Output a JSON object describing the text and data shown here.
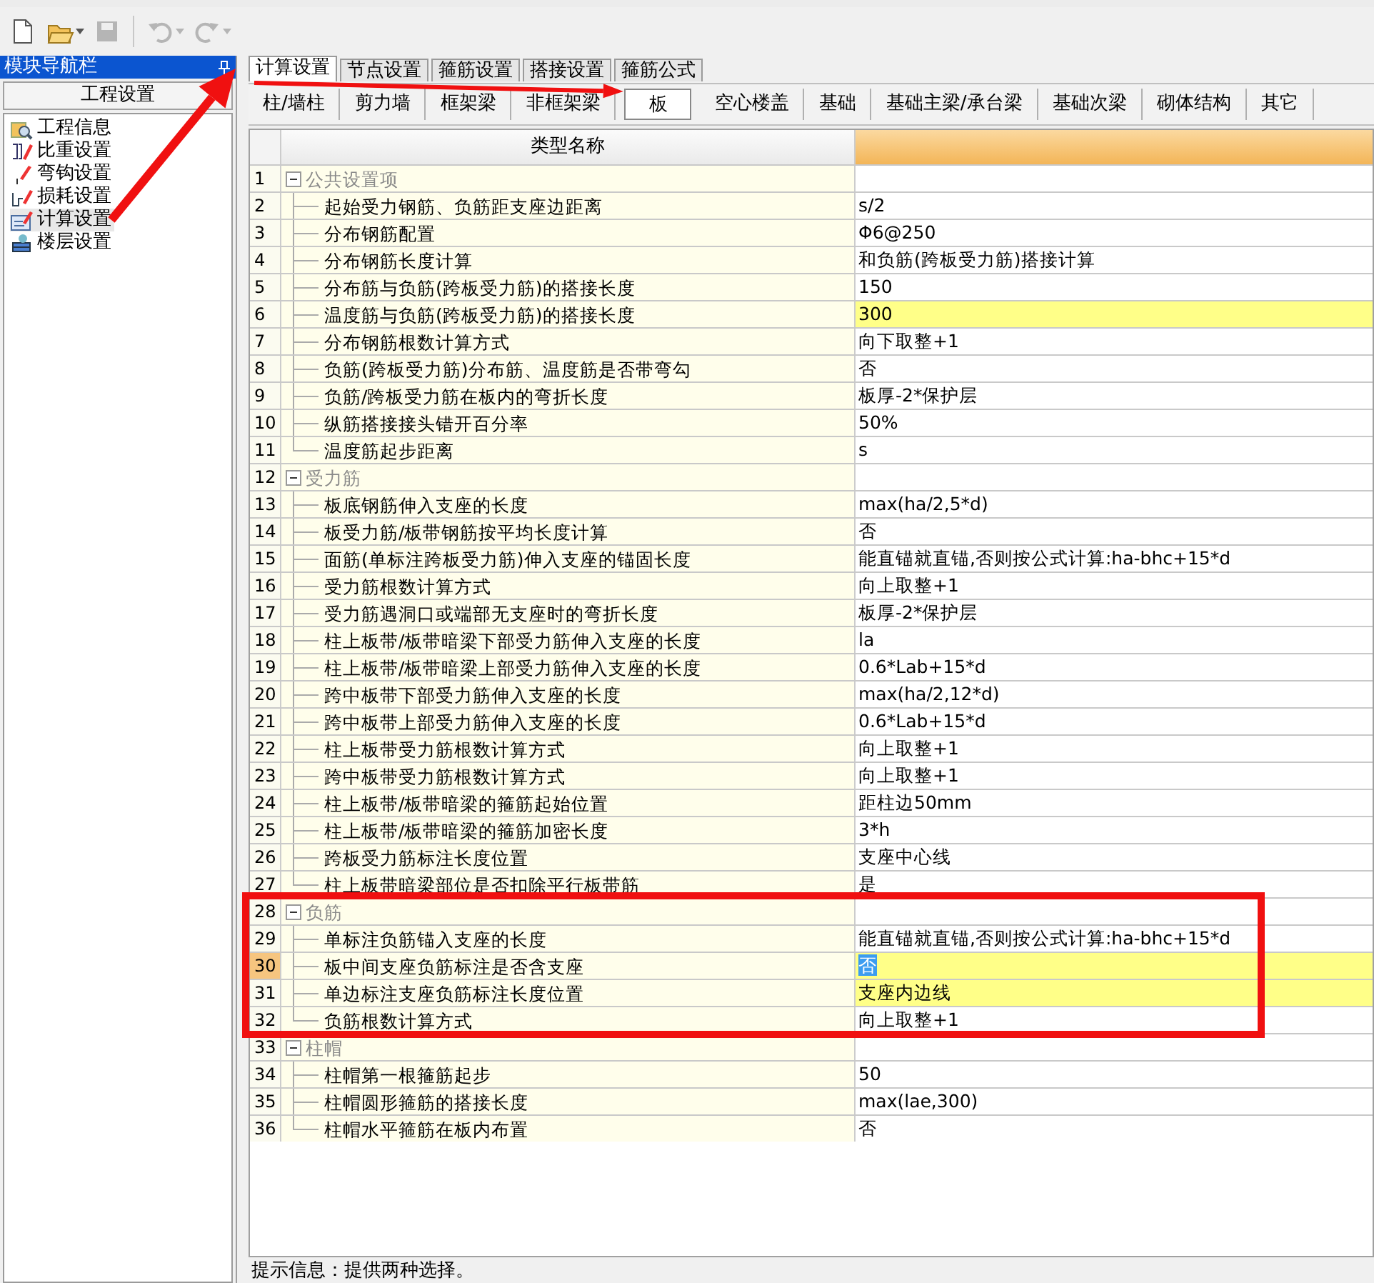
{
  "toolbar": [
    {
      "kind": "new",
      "disabled": false,
      "dropdown": false
    },
    {
      "kind": "open",
      "disabled": false,
      "dropdown": true
    },
    {
      "kind": "save",
      "disabled": true,
      "dropdown": false
    },
    {
      "kind": "undo",
      "disabled": true,
      "dropdown": true
    },
    {
      "kind": "redo",
      "disabled": true,
      "dropdown": true
    }
  ],
  "sidebar": {
    "title": "模块导航栏",
    "section": "工程设置",
    "items": [
      {
        "label": "工程信息",
        "selected": false
      },
      {
        "label": "比重设置",
        "selected": false
      },
      {
        "label": "弯钩设置",
        "selected": false
      },
      {
        "label": "损耗设置",
        "selected": false
      },
      {
        "label": "计算设置",
        "selected": true
      },
      {
        "label": "楼层设置",
        "selected": false
      }
    ]
  },
  "tabs": [
    {
      "label": "计算设置",
      "selected": true
    },
    {
      "label": "节点设置",
      "selected": false
    },
    {
      "label": "箍筋设置",
      "selected": false
    },
    {
      "label": "搭接设置",
      "selected": false
    },
    {
      "label": "箍筋公式",
      "selected": false
    }
  ],
  "subtabs": [
    {
      "label": "柱/墙柱",
      "selected": false
    },
    {
      "label": "剪力墙",
      "selected": false
    },
    {
      "label": "框架梁",
      "selected": false
    },
    {
      "label": "非框架梁",
      "selected": false
    },
    {
      "label": "板",
      "selected": true
    },
    {
      "label": "空心楼盖",
      "selected": false
    },
    {
      "label": "基础",
      "selected": false
    },
    {
      "label": "基础主梁/承台梁",
      "selected": false
    },
    {
      "label": "基础次梁",
      "selected": false
    },
    {
      "label": "砌体结构",
      "selected": false
    },
    {
      "label": "其它",
      "selected": false
    }
  ],
  "table": {
    "header": "类型名称",
    "groups": [
      {
        "no": "1",
        "name": "公共设置项",
        "expanded": true,
        "children": [
          {
            "no": "2",
            "name": "起始受力钢筋、负筋距支座边距离",
            "value": "s/2",
            "highlighted": false,
            "selected": false
          },
          {
            "no": "3",
            "name": "分布钢筋配置",
            "value": "Φ6@250",
            "highlighted": false,
            "selected": false
          },
          {
            "no": "4",
            "name": "分布钢筋长度计算",
            "value": "和负筋(跨板受力筋)搭接计算",
            "highlighted": false,
            "selected": false
          },
          {
            "no": "5",
            "name": "分布筋与负筋(跨板受力筋)的搭接长度",
            "value": "150",
            "highlighted": false,
            "selected": false
          },
          {
            "no": "6",
            "name": "温度筋与负筋(跨板受力筋)的搭接长度",
            "value": "300",
            "highlighted": true,
            "selected": false
          },
          {
            "no": "7",
            "name": "分布钢筋根数计算方式",
            "value": "向下取整+1",
            "highlighted": false,
            "selected": false
          },
          {
            "no": "8",
            "name": "负筋(跨板受力筋)分布筋、温度筋是否带弯勾",
            "value": "否",
            "highlighted": false,
            "selected": false
          },
          {
            "no": "9",
            "name": "负筋/跨板受力筋在板内的弯折长度",
            "value": "板厚-2*保护层",
            "highlighted": false,
            "selected": false
          },
          {
            "no": "10",
            "name": "纵筋搭接接头错开百分率",
            "value": "50%",
            "highlighted": false,
            "selected": false
          },
          {
            "no": "11",
            "name": "温度筋起步距离",
            "value": "s",
            "highlighted": false,
            "selected": false
          }
        ]
      },
      {
        "no": "12",
        "name": "受力筋",
        "expanded": true,
        "children": [
          {
            "no": "13",
            "name": "板底钢筋伸入支座的长度",
            "value": "max(ha/2,5*d)",
            "highlighted": false,
            "selected": false
          },
          {
            "no": "14",
            "name": "板受力筋/板带钢筋按平均长度计算",
            "value": "否",
            "highlighted": false,
            "selected": false
          },
          {
            "no": "15",
            "name": "面筋(单标注跨板受力筋)伸入支座的锚固长度",
            "value": "能直锚就直锚,否则按公式计算:ha-bhc+15*d",
            "highlighted": false,
            "selected": false
          },
          {
            "no": "16",
            "name": "受力筋根数计算方式",
            "value": "向上取整+1",
            "highlighted": false,
            "selected": false
          },
          {
            "no": "17",
            "name": "受力筋遇洞口或端部无支座时的弯折长度",
            "value": "板厚-2*保护层",
            "highlighted": false,
            "selected": false
          },
          {
            "no": "18",
            "name": "柱上板带/板带暗梁下部受力筋伸入支座的长度",
            "value": "la",
            "highlighted": false,
            "selected": false
          },
          {
            "no": "19",
            "name": "柱上板带/板带暗梁上部受力筋伸入支座的长度",
            "value": "0.6*Lab+15*d",
            "highlighted": false,
            "selected": false
          },
          {
            "no": "20",
            "name": "跨中板带下部受力筋伸入支座的长度",
            "value": "max(ha/2,12*d)",
            "highlighted": false,
            "selected": false
          },
          {
            "no": "21",
            "name": "跨中板带上部受力筋伸入支座的长度",
            "value": "0.6*Lab+15*d",
            "highlighted": false,
            "selected": false
          },
          {
            "no": "22",
            "name": "柱上板带受力筋根数计算方式",
            "value": "向上取整+1",
            "highlighted": false,
            "selected": false
          },
          {
            "no": "23",
            "name": "跨中板带受力筋根数计算方式",
            "value": "向上取整+1",
            "highlighted": false,
            "selected": false
          },
          {
            "no": "24",
            "name": "柱上板带/板带暗梁的箍筋起始位置",
            "value": "距柱边50mm",
            "highlighted": false,
            "selected": false
          },
          {
            "no": "25",
            "name": "柱上板带/板带暗梁的箍筋加密长度",
            "value": "3*h",
            "highlighted": false,
            "selected": false
          },
          {
            "no": "26",
            "name": "跨板受力筋标注长度位置",
            "value": "支座中心线",
            "highlighted": false,
            "selected": false
          },
          {
            "no": "27",
            "name": "柱上板带暗梁部位是否扣除平行板带筋",
            "value": "是",
            "highlighted": false,
            "selected": false
          }
        ]
      },
      {
        "no": "28",
        "name": "负筋",
        "expanded": true,
        "children": [
          {
            "no": "29",
            "name": "单标注负筋锚入支座的长度",
            "value": "能直锚就直锚,否则按公式计算:ha-bhc+15*d",
            "highlighted": false,
            "selected": false
          },
          {
            "no": "30",
            "name": "板中间支座负筋标注是否含支座",
            "value": "否",
            "highlighted": true,
            "selected": true
          },
          {
            "no": "31",
            "name": "单边标注支座负筋标注长度位置",
            "value": "支座内边线",
            "highlighted": true,
            "selected": false
          },
          {
            "no": "32",
            "name": "负筋根数计算方式",
            "value": "向上取整+1",
            "highlighted": false,
            "selected": false
          }
        ]
      },
      {
        "no": "33",
        "name": "柱帽",
        "expanded": true,
        "children": [
          {
            "no": "34",
            "name": "柱帽第一根箍筋起步",
            "value": "50",
            "highlighted": false,
            "selected": false
          },
          {
            "no": "35",
            "name": "柱帽圆形箍筋的搭接长度",
            "value": "max(lae,300)",
            "highlighted": false,
            "selected": false
          },
          {
            "no": "36",
            "name": "柱帽水平箍筋在板内布置",
            "value": "否",
            "highlighted": false,
            "selected": false
          }
        ]
      }
    ]
  },
  "status_bar": "提示信息：提供两种选择。"
}
